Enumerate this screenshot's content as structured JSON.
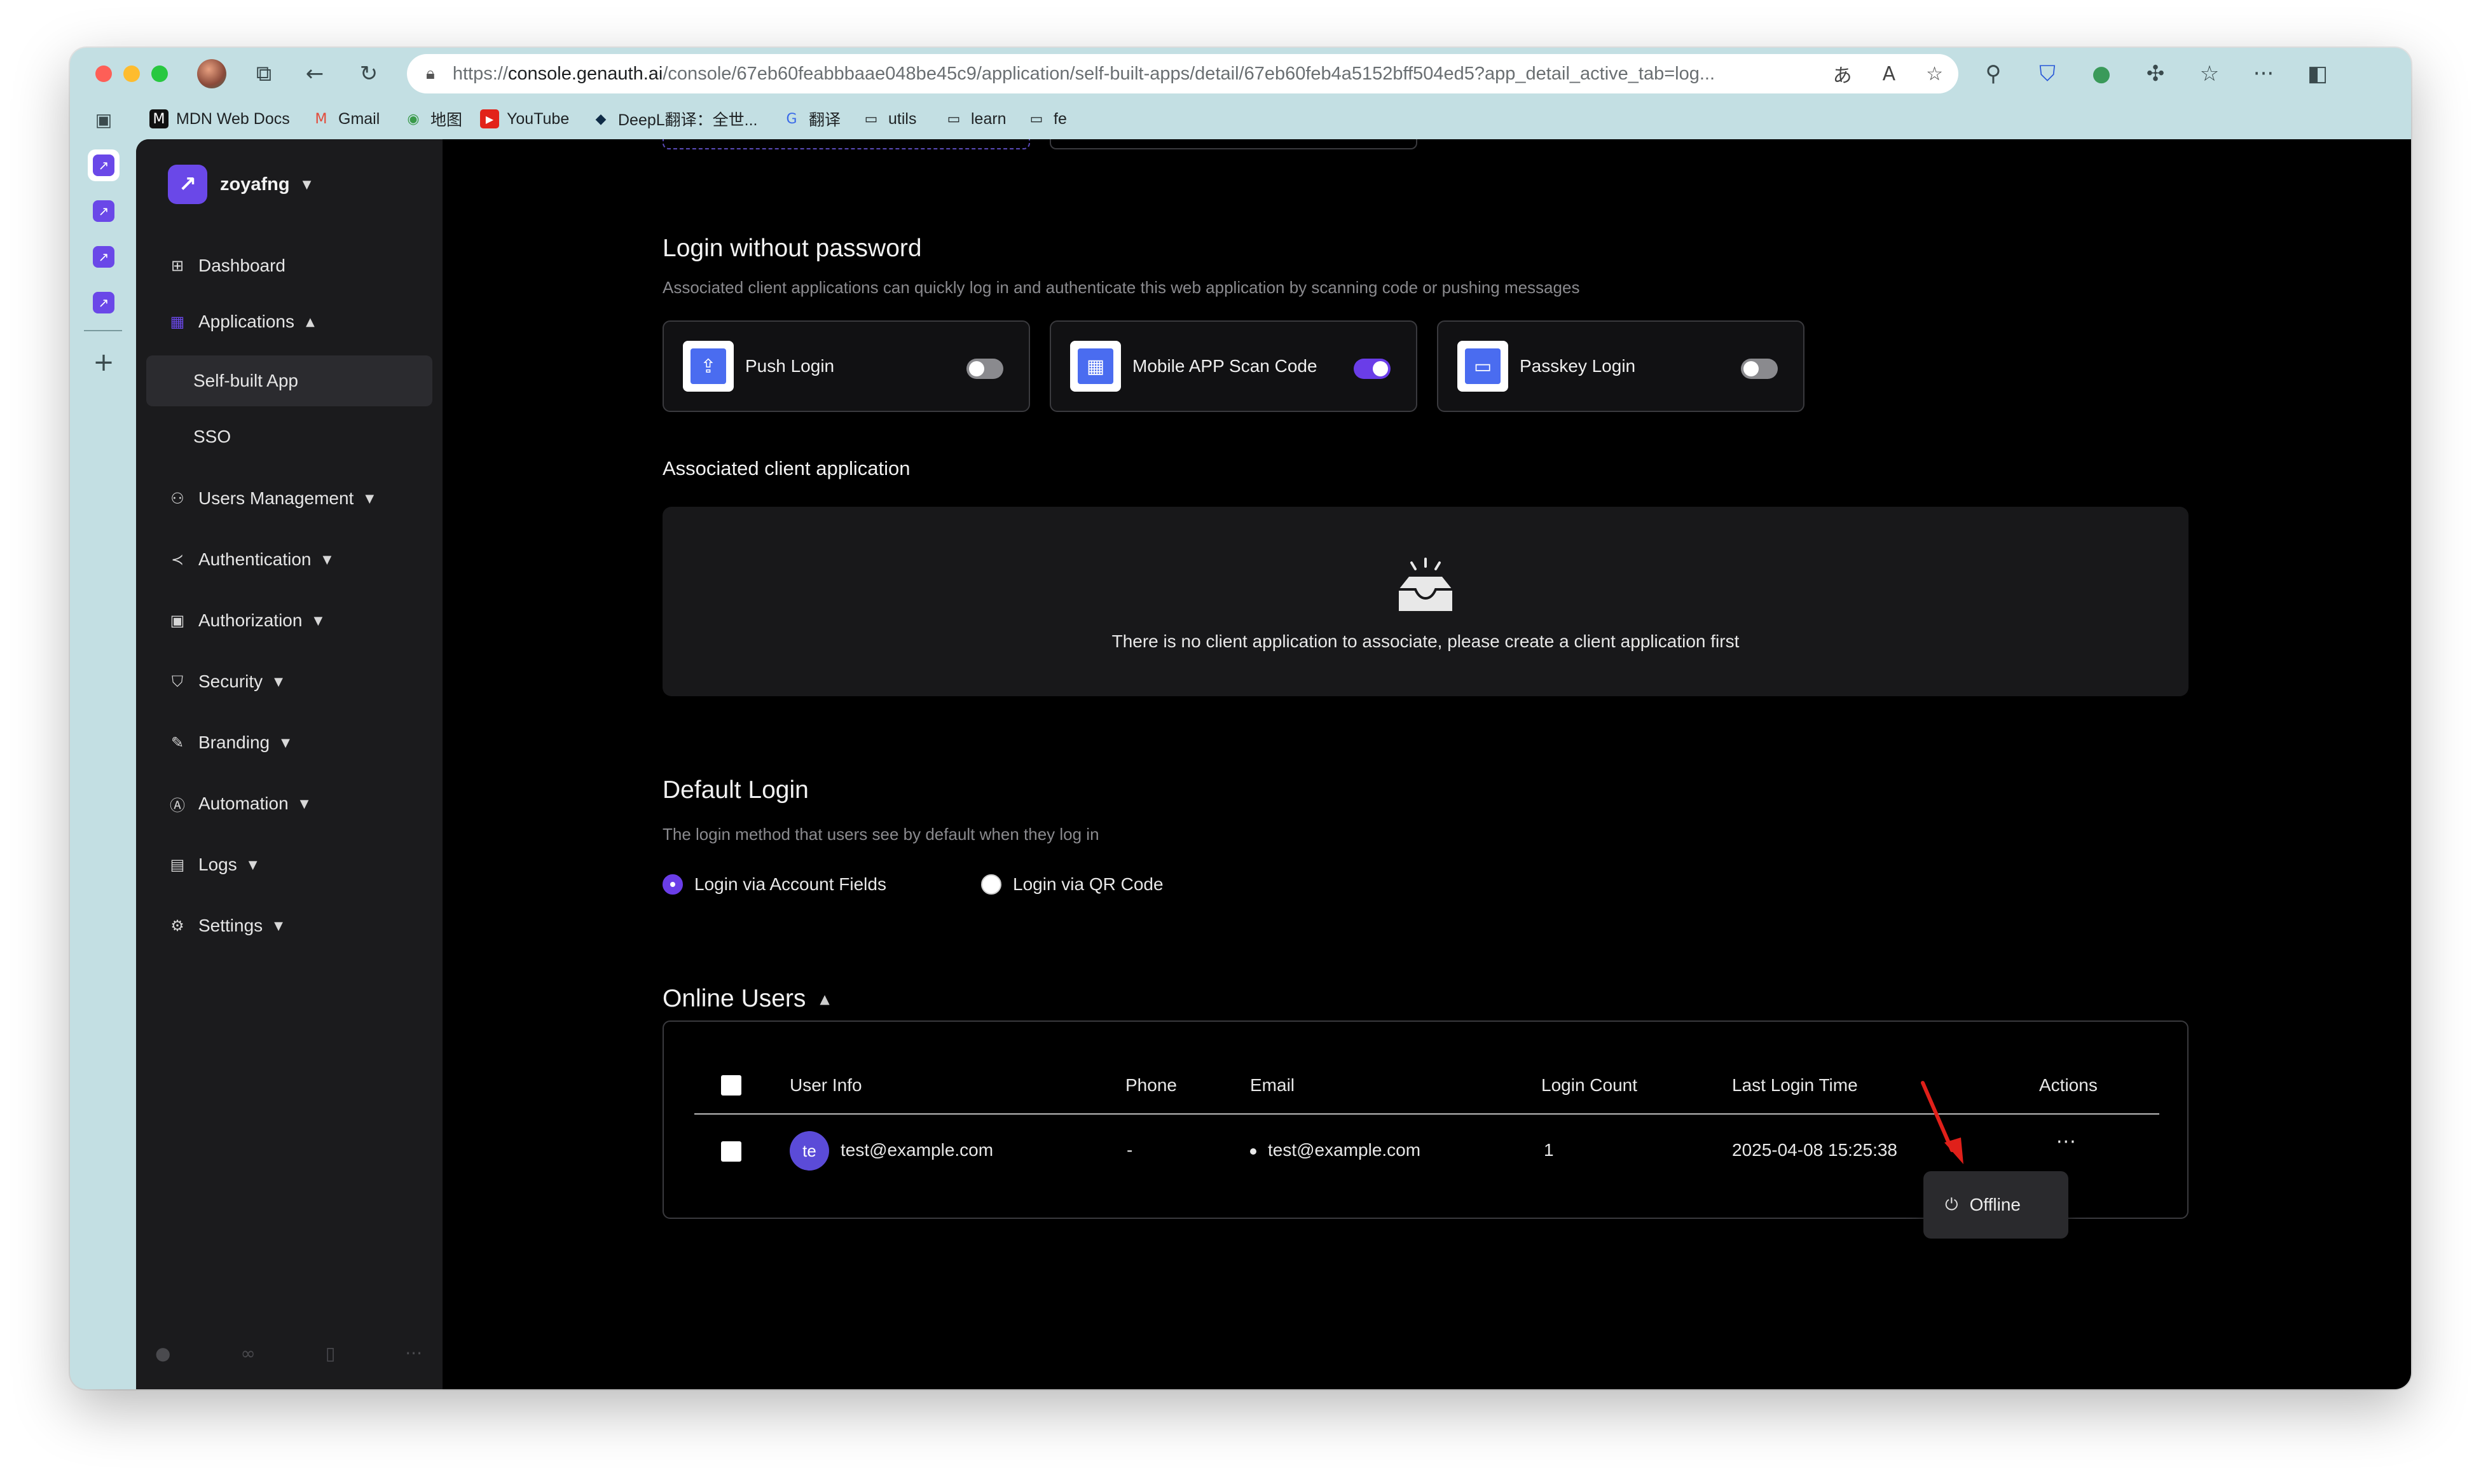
{
  "browser": {
    "url_prefix": "https://",
    "url_domain": "console.genauth.ai",
    "url_path": "/console/67eb60feabbbaae048be45c9/application/self-built-apps/detail/67eb60feb4a5152bff504ed5?app_detail_active_tab=log...",
    "bookmarks": [
      {
        "label": "MDN Web Docs",
        "icon": "M"
      },
      {
        "label": "Gmail",
        "icon": "M"
      },
      {
        "label": "地图",
        "icon": "◉"
      },
      {
        "label": "YouTube",
        "icon": "▶"
      },
      {
        "label": "DeepL翻译：全世...",
        "icon": "◆"
      },
      {
        "label": "翻译",
        "icon": "G"
      },
      {
        "label": "utils",
        "icon": "▭"
      },
      {
        "label": "learn",
        "icon": "▭"
      },
      {
        "label": "fe",
        "icon": "▭"
      }
    ]
  },
  "sidebar": {
    "org_name": "zoyafng",
    "items": [
      {
        "label": "Dashboard",
        "icon": "dashboard-icon"
      },
      {
        "label": "Applications",
        "icon": "applications-icon"
      },
      {
        "label": "Self-built App"
      },
      {
        "label": "SSO"
      },
      {
        "label": "Users Management",
        "icon": "users-icon"
      },
      {
        "label": "Authentication",
        "icon": "share-icon"
      },
      {
        "label": "Authorization",
        "icon": "lock-icon"
      },
      {
        "label": "Security",
        "icon": "shield-icon"
      },
      {
        "label": "Branding",
        "icon": "brush-icon"
      },
      {
        "label": "Automation",
        "icon": "automation-icon"
      },
      {
        "label": "Logs",
        "icon": "logs-icon"
      },
      {
        "label": "Settings",
        "icon": "gear-icon"
      }
    ]
  },
  "passwordless": {
    "title": "Login without password",
    "description": "Associated client applications can quickly log in and authenticate this web application by scanning code or pushing messages",
    "cards": [
      {
        "label": "Push Login",
        "enabled": false
      },
      {
        "label": "Mobile APP Scan Code",
        "enabled": true
      },
      {
        "label": "Passkey Login",
        "enabled": false
      }
    ]
  },
  "associated": {
    "title": "Associated client application",
    "empty_text": "There is no client application to associate, please create a client application first"
  },
  "default_login": {
    "title": "Default Login",
    "description": "The login method that users see by default when they log in",
    "options": [
      {
        "label": "Login via Account Fields",
        "checked": true
      },
      {
        "label": "Login via QR Code",
        "checked": false
      }
    ]
  },
  "online_users": {
    "title": "Online Users",
    "columns": [
      "User Info",
      "Phone",
      "Email",
      "Login Count",
      "Last Login Time",
      "Actions"
    ],
    "rows": [
      {
        "avatar": "te",
        "user": "test@example.com",
        "phone": "-",
        "email": "test@example.com",
        "login_count": "1",
        "last_login": "2025-04-08 15:25:38",
        "actions": "···"
      }
    ],
    "menu": {
      "item": "Offline"
    }
  },
  "colors": {
    "accent": "#6a3de8",
    "annotation_arrow": "#e0201a"
  }
}
